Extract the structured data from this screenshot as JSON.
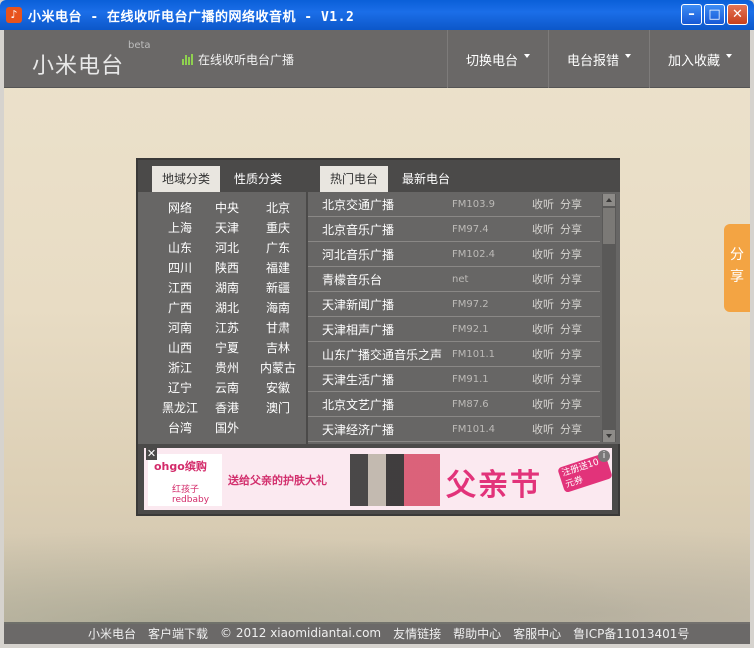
{
  "window": {
    "title": "小米电台 - 在线收听电台广播的网络收音机 - V1.2",
    "icon_glyph": "♪",
    "min_glyph": "–",
    "max_glyph": "□",
    "close_glyph": "✕"
  },
  "header": {
    "logo": "小米电台",
    "beta": "beta",
    "slogan": "在线收听电台广播",
    "nav": [
      {
        "label": "切换电台"
      },
      {
        "label": "电台报错"
      },
      {
        "label": "加入收藏"
      }
    ]
  },
  "share_tab": {
    "label": "分享"
  },
  "left_panel": {
    "tabs": [
      {
        "label": "地域分类"
      },
      {
        "label": "性质分类"
      }
    ],
    "regions": [
      "网络",
      "中央",
      "北京",
      "上海",
      "天津",
      "重庆",
      "山东",
      "河北",
      "广东",
      "四川",
      "陕西",
      "福建",
      "江西",
      "湖南",
      "新疆",
      "广西",
      "湖北",
      "海南",
      "河南",
      "江苏",
      "甘肃",
      "山西",
      "宁夏",
      "吉林",
      "浙江",
      "贵州",
      "内蒙古",
      "辽宁",
      "云南",
      "安徽",
      "黑龙江",
      "香港",
      "澳门",
      "台湾",
      "国外"
    ]
  },
  "right_panel": {
    "tabs": [
      {
        "label": "热门电台"
      },
      {
        "label": "最新电台"
      }
    ],
    "listen_label": "收听",
    "share_label": "分享",
    "stations": [
      {
        "name": "北京交通广播",
        "freq": "FM103.9"
      },
      {
        "name": "北京音乐广播",
        "freq": "FM97.4"
      },
      {
        "name": "河北音乐广播",
        "freq": "FM102.4"
      },
      {
        "name": "青檬音乐台",
        "freq": "net"
      },
      {
        "name": "天津新闻广播",
        "freq": "FM97.2"
      },
      {
        "name": "天津相声广播",
        "freq": "FM92.1"
      },
      {
        "name": "山东广播交通音乐之声",
        "freq": "FM101.1"
      },
      {
        "name": "天津生活广播",
        "freq": "FM91.1"
      },
      {
        "name": "北京文艺广播",
        "freq": "FM87.6"
      },
      {
        "name": "天津经济广播",
        "freq": "FM101.4"
      }
    ]
  },
  "ad": {
    "brand1": "ohgo缤购",
    "brand2": "红孩子 redbaby",
    "slogan": "送给父亲的护肤大礼",
    "festival": "父亲节",
    "badge": "注册送10元券",
    "info": "i",
    "close": "✕"
  },
  "footer": {
    "items": [
      "小米电台",
      "客户端下载",
      "© 2012 xiaomidiantai.com",
      "友情链接",
      "帮助中心",
      "客服中心",
      "鲁ICP备11013401号"
    ]
  },
  "colors": {
    "titlebar": "#0a5fd8",
    "header_bg": "#6a6867",
    "panel_bg": "#676665",
    "share_tab": "#f3a443",
    "ad_pink": "#e2337a"
  }
}
